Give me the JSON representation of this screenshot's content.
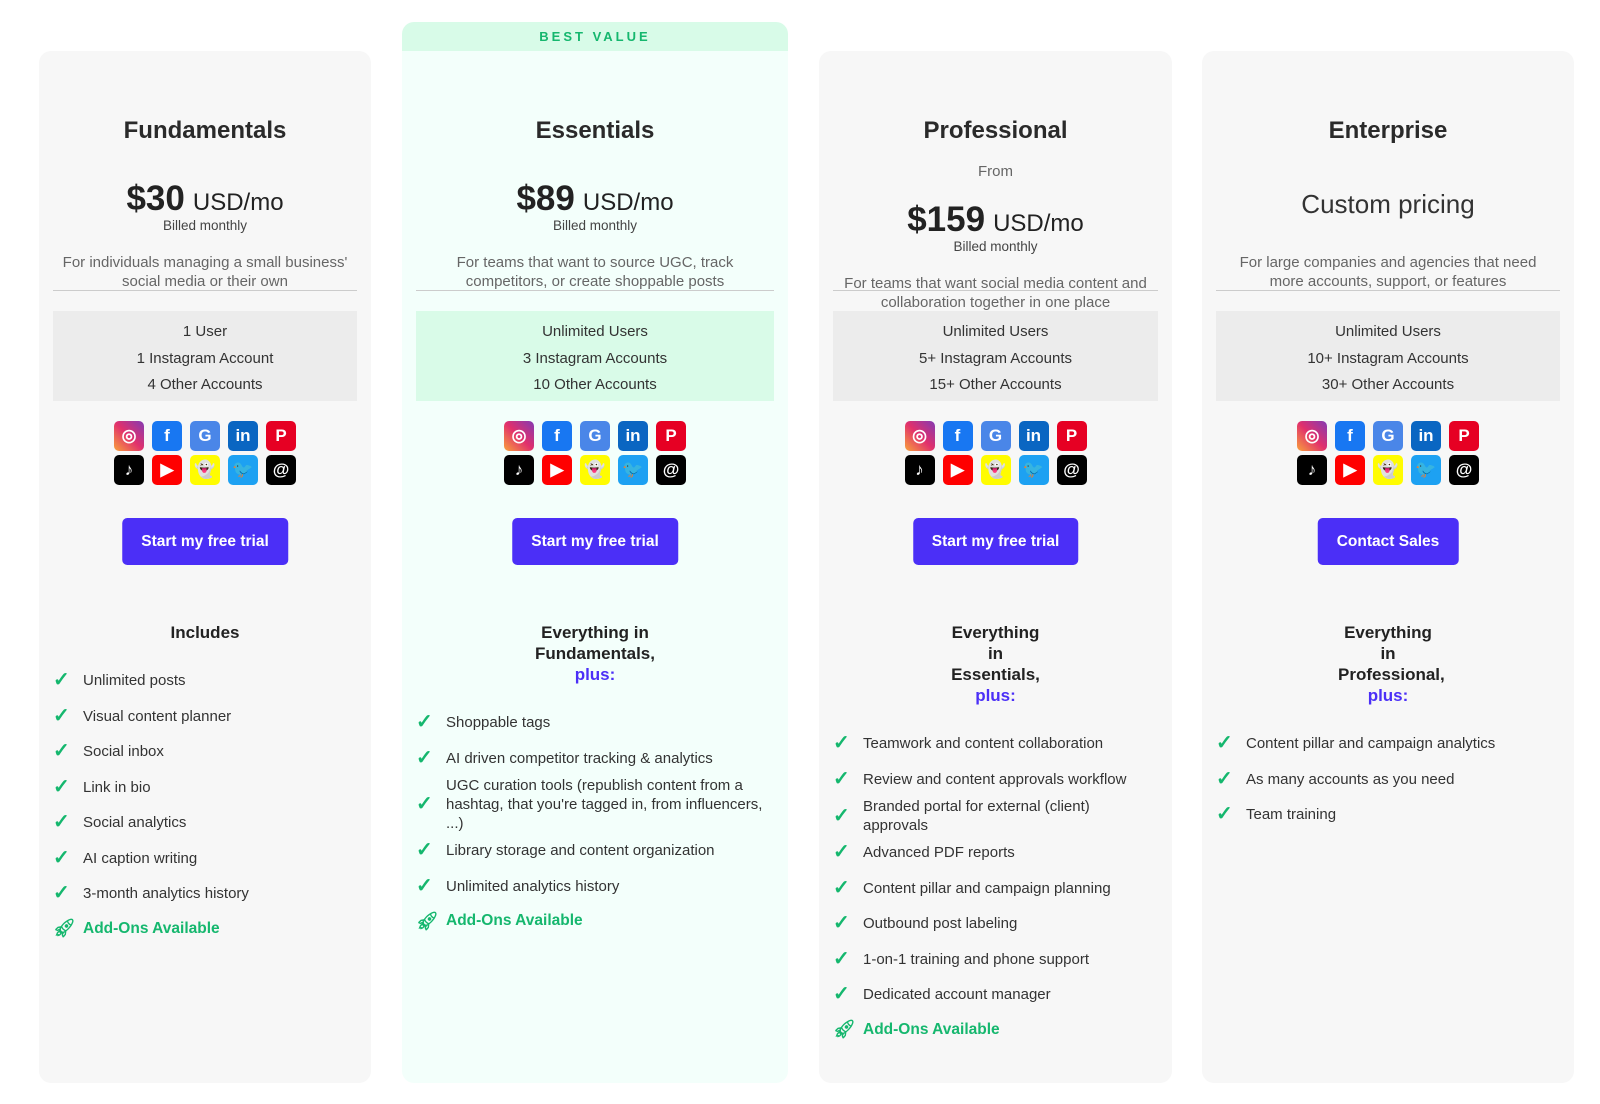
{
  "banner": "BEST VALUE",
  "colors": {
    "accent": "#4b2ff7",
    "green": "#15b76e"
  },
  "social_icons": [
    "instagram-icon",
    "facebook-icon",
    "google-business-icon",
    "linkedin-icon",
    "pinterest-icon",
    "tiktok-icon",
    "youtube-icon",
    "snapchat-icon",
    "twitter-icon",
    "threads-icon"
  ],
  "plans": [
    {
      "name": "Fundamentals",
      "amount": "$30",
      "unit": "USD/mo",
      "billed": "Billed monthly",
      "desc": "For individuals managing a small business' social media or their own",
      "accounts": [
        "1 User",
        "1 Instagram Account",
        "4 Other Accounts"
      ],
      "cta": "Start my free trial",
      "features_heading": "Includes",
      "features": [
        "Unlimited posts",
        "Visual content planner",
        "Social inbox",
        "Link in bio",
        "Social analytics",
        "AI caption writing",
        "3-month analytics history"
      ],
      "addons": "Add-Ons Available"
    },
    {
      "name": "Essentials",
      "amount": "$89",
      "unit": "USD/mo",
      "billed": "Billed monthly",
      "desc": "For teams that want to source UGC, track competitors, or create shoppable posts",
      "accounts": [
        "Unlimited Users",
        "3 Instagram Accounts",
        "10 Other Accounts"
      ],
      "cta": "Start my free trial",
      "features_heading": "Everything in Fundamentals,",
      "plus": "plus:",
      "features": [
        "Shoppable tags",
        "AI driven competitor tracking & analytics",
        "UGC curation tools (republish content from a hashtag, that you're tagged in, from influencers, ...)",
        "Library storage and content organization",
        "Unlimited analytics history"
      ],
      "addons": "Add-Ons Available"
    },
    {
      "name": "Professional",
      "from": "From",
      "amount": "$159",
      "unit": "USD/mo",
      "billed": "Billed monthly",
      "desc": "For teams that want social media content and collaboration together in one place",
      "accounts": [
        "Unlimited Users",
        "5+ Instagram Accounts",
        "15+ Other Accounts"
      ],
      "cta": "Start my free trial",
      "features_heading": "Everything in Essentials,",
      "plus": "plus:",
      "features": [
        "Teamwork and content collaboration",
        "Review and content approvals workflow",
        "Branded portal for external (client) approvals",
        "Advanced PDF reports",
        "Content pillar and campaign planning",
        "Outbound post labeling",
        "1-on-1 training and phone support",
        "Dedicated account manager"
      ],
      "addons": "Add-Ons Available"
    },
    {
      "name": "Enterprise",
      "custom": "Custom pricing",
      "desc": "For large companies and agencies that need more accounts, support, or features",
      "accounts": [
        "Unlimited Users",
        "10+ Instagram Accounts",
        "30+ Other Accounts"
      ],
      "cta": "Contact Sales",
      "features_heading": "Everything in Professional,",
      "plus": "plus:",
      "features": [
        "Content pillar and campaign analytics",
        "As many accounts as you need",
        "Team training"
      ]
    }
  ]
}
